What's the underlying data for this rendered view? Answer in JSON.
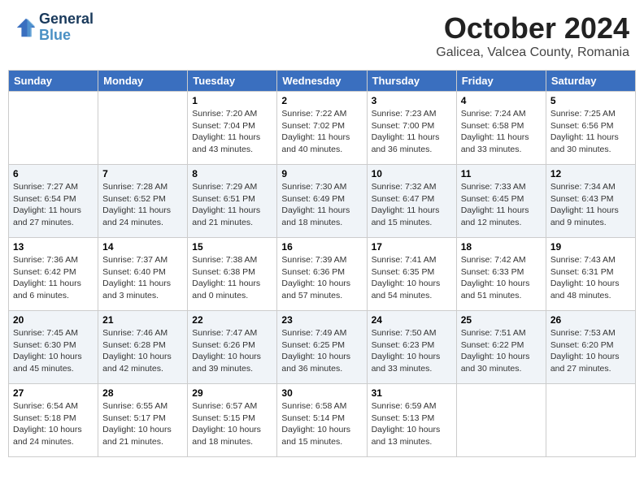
{
  "header": {
    "logo_line1": "General",
    "logo_line2": "Blue",
    "month": "October 2024",
    "location": "Galicea, Valcea County, Romania"
  },
  "weekdays": [
    "Sunday",
    "Monday",
    "Tuesday",
    "Wednesday",
    "Thursday",
    "Friday",
    "Saturday"
  ],
  "weeks": [
    [
      {
        "day": "",
        "info": ""
      },
      {
        "day": "",
        "info": ""
      },
      {
        "day": "1",
        "info": "Sunrise: 7:20 AM\nSunset: 7:04 PM\nDaylight: 11 hours and 43 minutes."
      },
      {
        "day": "2",
        "info": "Sunrise: 7:22 AM\nSunset: 7:02 PM\nDaylight: 11 hours and 40 minutes."
      },
      {
        "day": "3",
        "info": "Sunrise: 7:23 AM\nSunset: 7:00 PM\nDaylight: 11 hours and 36 minutes."
      },
      {
        "day": "4",
        "info": "Sunrise: 7:24 AM\nSunset: 6:58 PM\nDaylight: 11 hours and 33 minutes."
      },
      {
        "day": "5",
        "info": "Sunrise: 7:25 AM\nSunset: 6:56 PM\nDaylight: 11 hours and 30 minutes."
      }
    ],
    [
      {
        "day": "6",
        "info": "Sunrise: 7:27 AM\nSunset: 6:54 PM\nDaylight: 11 hours and 27 minutes."
      },
      {
        "day": "7",
        "info": "Sunrise: 7:28 AM\nSunset: 6:52 PM\nDaylight: 11 hours and 24 minutes."
      },
      {
        "day": "8",
        "info": "Sunrise: 7:29 AM\nSunset: 6:51 PM\nDaylight: 11 hours and 21 minutes."
      },
      {
        "day": "9",
        "info": "Sunrise: 7:30 AM\nSunset: 6:49 PM\nDaylight: 11 hours and 18 minutes."
      },
      {
        "day": "10",
        "info": "Sunrise: 7:32 AM\nSunset: 6:47 PM\nDaylight: 11 hours and 15 minutes."
      },
      {
        "day": "11",
        "info": "Sunrise: 7:33 AM\nSunset: 6:45 PM\nDaylight: 11 hours and 12 minutes."
      },
      {
        "day": "12",
        "info": "Sunrise: 7:34 AM\nSunset: 6:43 PM\nDaylight: 11 hours and 9 minutes."
      }
    ],
    [
      {
        "day": "13",
        "info": "Sunrise: 7:36 AM\nSunset: 6:42 PM\nDaylight: 11 hours and 6 minutes."
      },
      {
        "day": "14",
        "info": "Sunrise: 7:37 AM\nSunset: 6:40 PM\nDaylight: 11 hours and 3 minutes."
      },
      {
        "day": "15",
        "info": "Sunrise: 7:38 AM\nSunset: 6:38 PM\nDaylight: 11 hours and 0 minutes."
      },
      {
        "day": "16",
        "info": "Sunrise: 7:39 AM\nSunset: 6:36 PM\nDaylight: 10 hours and 57 minutes."
      },
      {
        "day": "17",
        "info": "Sunrise: 7:41 AM\nSunset: 6:35 PM\nDaylight: 10 hours and 54 minutes."
      },
      {
        "day": "18",
        "info": "Sunrise: 7:42 AM\nSunset: 6:33 PM\nDaylight: 10 hours and 51 minutes."
      },
      {
        "day": "19",
        "info": "Sunrise: 7:43 AM\nSunset: 6:31 PM\nDaylight: 10 hours and 48 minutes."
      }
    ],
    [
      {
        "day": "20",
        "info": "Sunrise: 7:45 AM\nSunset: 6:30 PM\nDaylight: 10 hours and 45 minutes."
      },
      {
        "day": "21",
        "info": "Sunrise: 7:46 AM\nSunset: 6:28 PM\nDaylight: 10 hours and 42 minutes."
      },
      {
        "day": "22",
        "info": "Sunrise: 7:47 AM\nSunset: 6:26 PM\nDaylight: 10 hours and 39 minutes."
      },
      {
        "day": "23",
        "info": "Sunrise: 7:49 AM\nSunset: 6:25 PM\nDaylight: 10 hours and 36 minutes."
      },
      {
        "day": "24",
        "info": "Sunrise: 7:50 AM\nSunset: 6:23 PM\nDaylight: 10 hours and 33 minutes."
      },
      {
        "day": "25",
        "info": "Sunrise: 7:51 AM\nSunset: 6:22 PM\nDaylight: 10 hours and 30 minutes."
      },
      {
        "day": "26",
        "info": "Sunrise: 7:53 AM\nSunset: 6:20 PM\nDaylight: 10 hours and 27 minutes."
      }
    ],
    [
      {
        "day": "27",
        "info": "Sunrise: 6:54 AM\nSunset: 5:18 PM\nDaylight: 10 hours and 24 minutes."
      },
      {
        "day": "28",
        "info": "Sunrise: 6:55 AM\nSunset: 5:17 PM\nDaylight: 10 hours and 21 minutes."
      },
      {
        "day": "29",
        "info": "Sunrise: 6:57 AM\nSunset: 5:15 PM\nDaylight: 10 hours and 18 minutes."
      },
      {
        "day": "30",
        "info": "Sunrise: 6:58 AM\nSunset: 5:14 PM\nDaylight: 10 hours and 15 minutes."
      },
      {
        "day": "31",
        "info": "Sunrise: 6:59 AM\nSunset: 5:13 PM\nDaylight: 10 hours and 13 minutes."
      },
      {
        "day": "",
        "info": ""
      },
      {
        "day": "",
        "info": ""
      }
    ]
  ]
}
